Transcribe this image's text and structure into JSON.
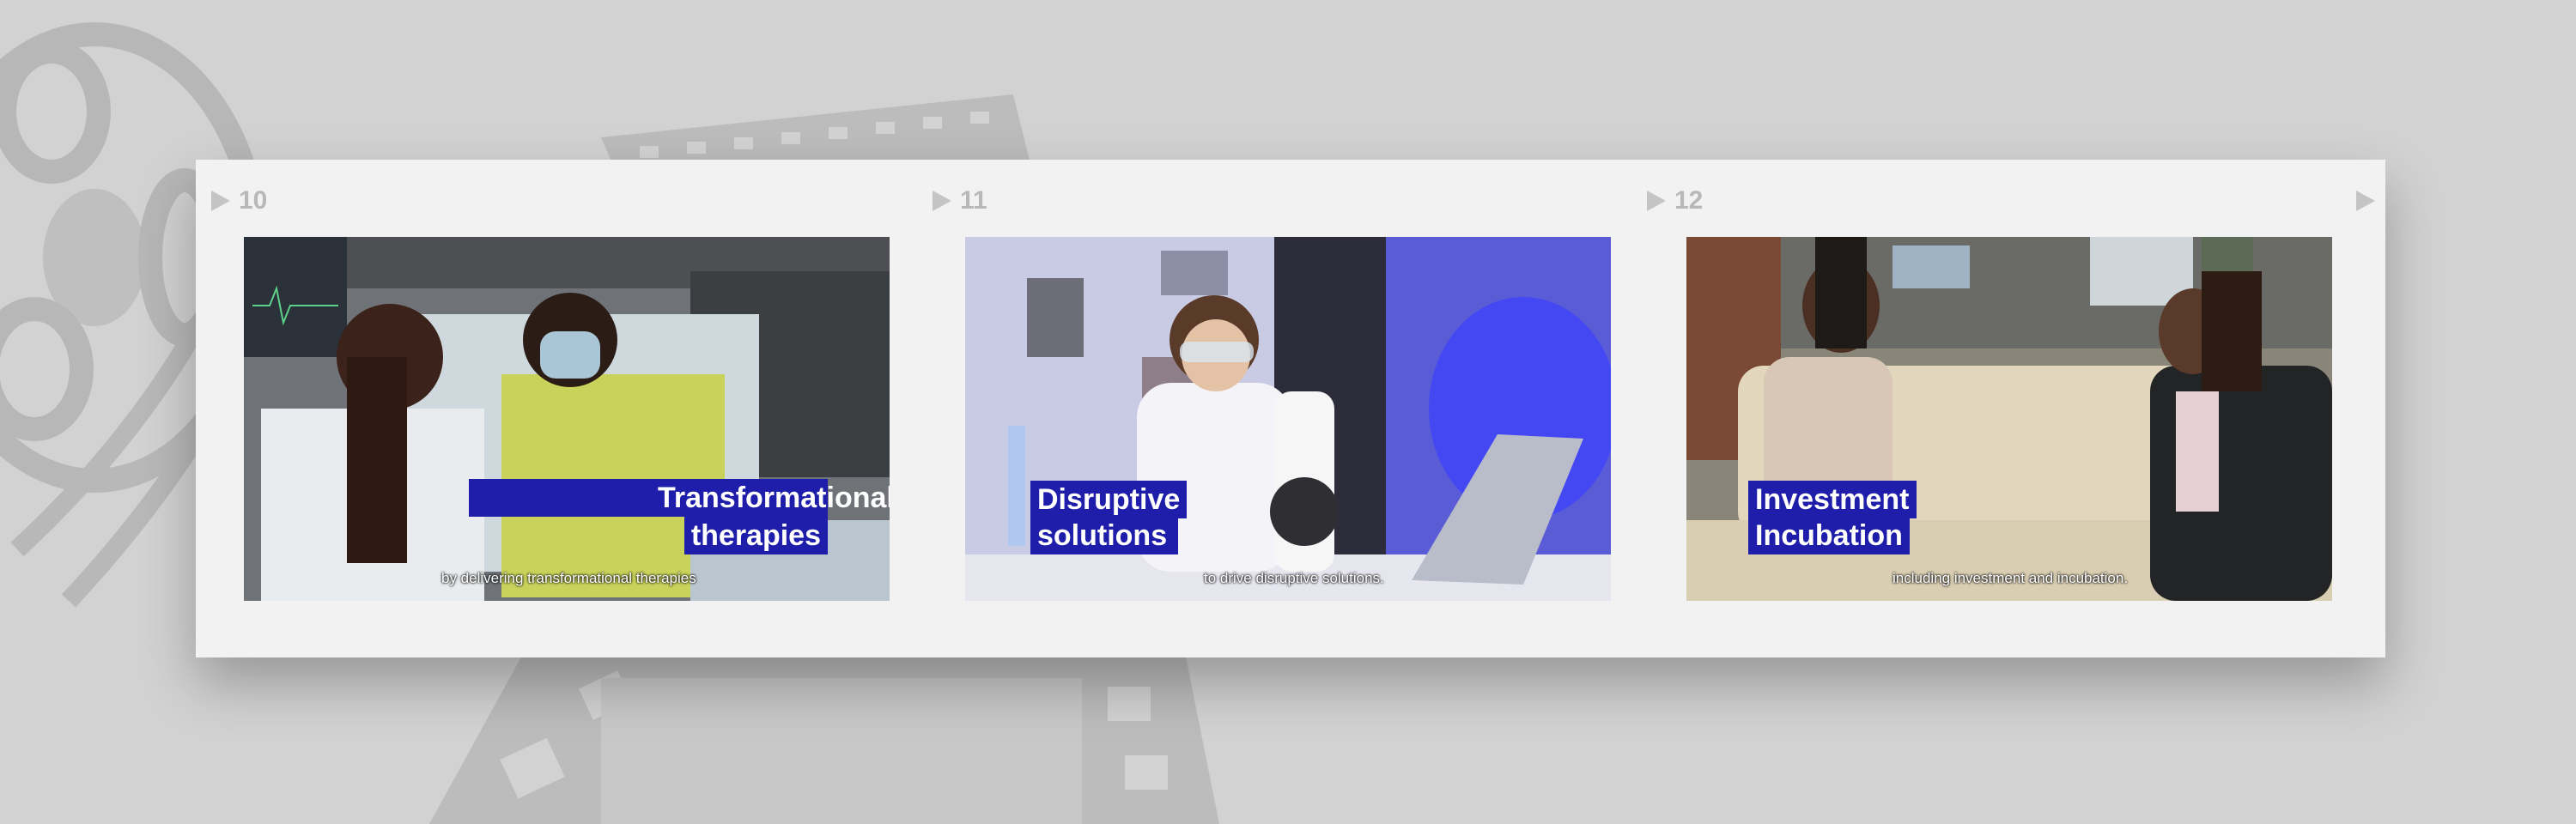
{
  "frames": [
    {
      "number": "10",
      "title_line1": "Transformational",
      "title_line2": "therapies",
      "caption": "by delivering transformational therapies"
    },
    {
      "number": "11",
      "title_line1": "Disruptive",
      "title_line2": "solutions",
      "caption": "to drive disruptive solutions."
    },
    {
      "number": "12",
      "title_line1": "Investment",
      "title_line2": "Incubation",
      "caption": "including investment and incubation."
    }
  ],
  "colors": {
    "background": "#d2d2d2",
    "board": "#f2f2f2",
    "title_bar": "#1e1eaa",
    "frame_number": "#b8b8b8"
  },
  "icons": [
    "film-reel-icon",
    "film-strip-icon",
    "play-marker-icon"
  ]
}
